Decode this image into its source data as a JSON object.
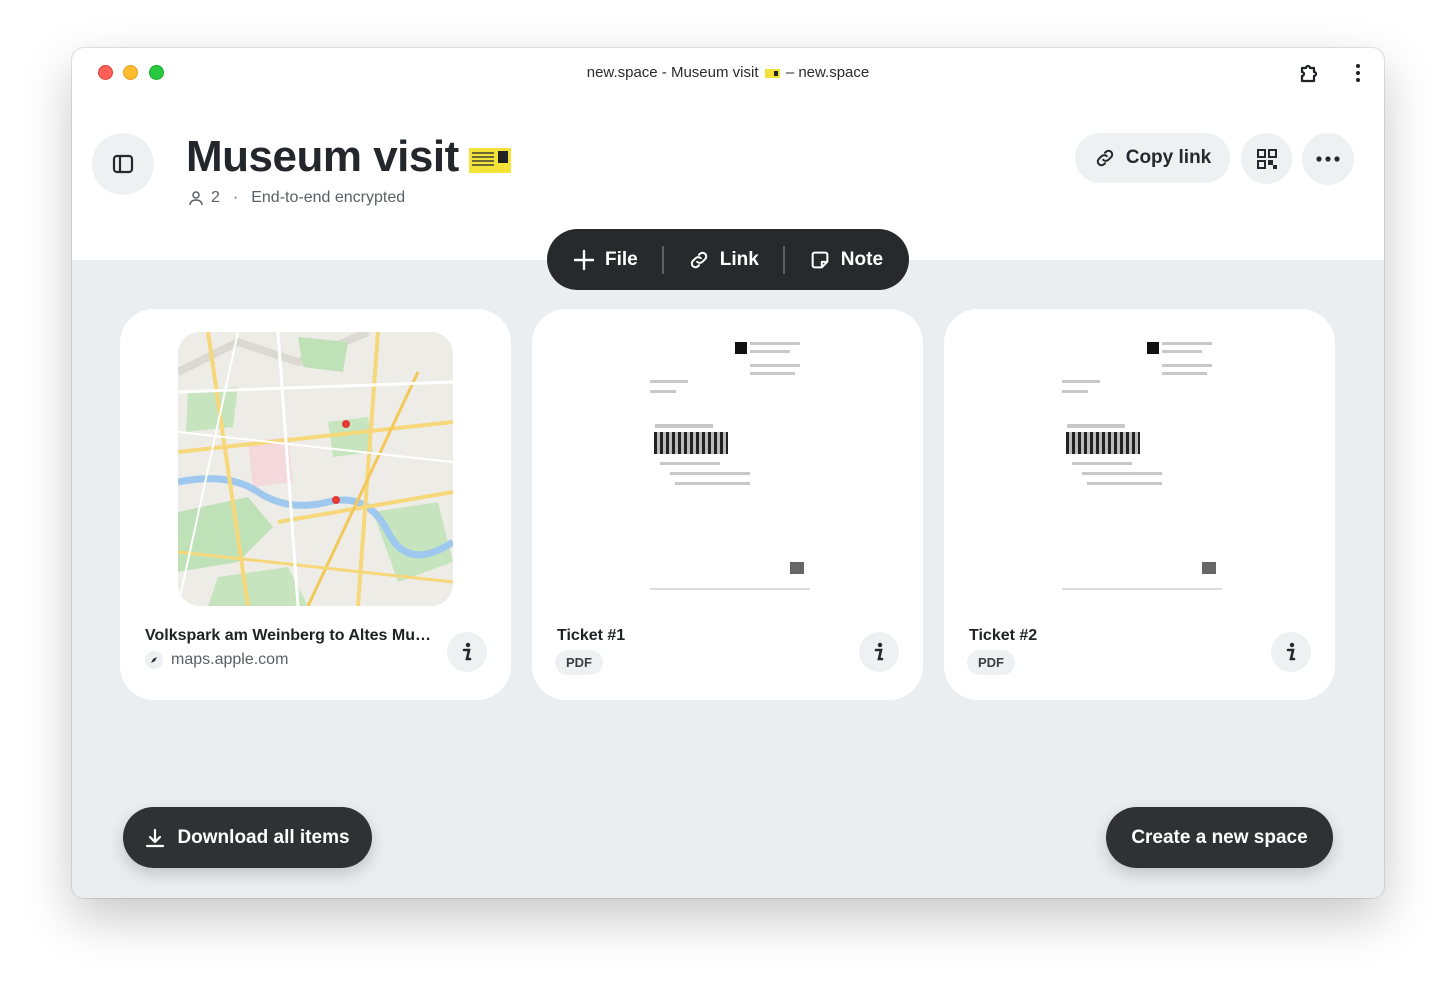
{
  "window": {
    "title_prefix": "new.space - Museum visit",
    "title_suffix": "– new.space"
  },
  "header": {
    "title": "Museum visit",
    "member_count": "2",
    "separator": "·",
    "encryption": "End-to-end encrypted",
    "copy_link_label": "Copy link"
  },
  "toolbar": {
    "file_label": "File",
    "link_label": "Link",
    "note_label": "Note"
  },
  "cards": [
    {
      "name": "Volkspark am Weinberg to Altes Museum",
      "source": "maps.apple.com",
      "type": "link"
    },
    {
      "name": "Ticket #1",
      "badge": "PDF",
      "type": "pdf"
    },
    {
      "name": "Ticket #2",
      "badge": "PDF",
      "type": "pdf"
    }
  ],
  "footer": {
    "download_label": "Download all items",
    "create_label": "Create a new space"
  },
  "icons": {
    "sidebar": "sidebar-icon",
    "extension": "puzzle-icon",
    "menu": "kebab-icon",
    "copy": "link-icon",
    "qr": "qr-code-icon",
    "more": "more-icon",
    "info": "info-icon",
    "download": "download-icon"
  },
  "colors": {
    "dark_button": "#2f3135",
    "content_bg": "#ebeef1",
    "pill_bg": "#eef0f2"
  }
}
